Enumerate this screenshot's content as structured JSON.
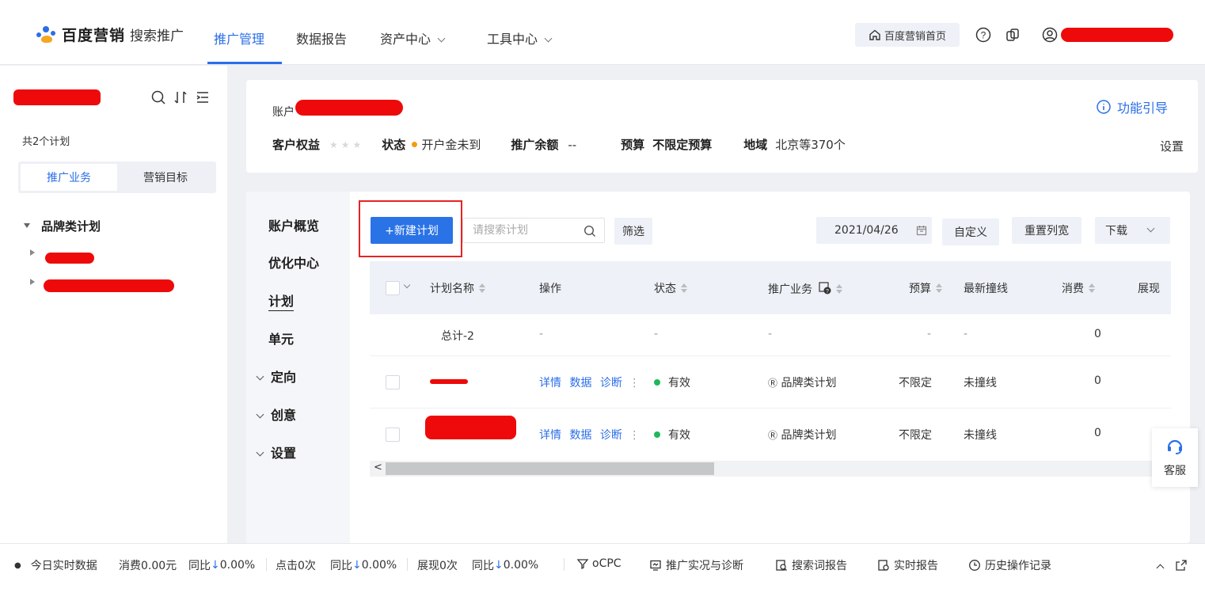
{
  "header": {
    "brand": "百度营销",
    "product": "搜索推广",
    "nav": [
      "推广管理",
      "数据报告",
      "资产中心",
      "工具中心"
    ],
    "home_button": "百度营销首页"
  },
  "sidebar": {
    "plan_count": "共2个计划",
    "tabs": [
      "推广业务",
      "营销目标"
    ],
    "tree_root": "品牌类计划"
  },
  "account": {
    "label": "账户",
    "rights_label": "客户权益",
    "status_label": "状态",
    "status_value": "开户金未到",
    "balance_label": "推广余额",
    "balance_value": "--",
    "budget_label": "预算",
    "budget_value": "不限定预算",
    "region_label": "地域",
    "region_value": "北京等370个",
    "guide": "功能引导",
    "settings": "设置"
  },
  "left_nav": [
    "账户概览",
    "优化中心",
    "计划",
    "单元",
    "定向",
    "创意",
    "设置"
  ],
  "toolbar": {
    "new_plan": "+新建计划",
    "search_placeholder": "请搜索计划",
    "filter": "筛选",
    "date": "2021/04/26",
    "custom": "自定义",
    "reset_width": "重置列宽",
    "download": "下载"
  },
  "table": {
    "headers": [
      "计划名称",
      "操作",
      "状态",
      "推广业务",
      "预算",
      "最新撞线",
      "消费",
      "展现"
    ],
    "total": {
      "name": "总计-2",
      "op": "-",
      "status": "-",
      "business": "-",
      "budget": "-",
      "latest": "-",
      "cost": "0"
    },
    "rows": [
      {
        "actions": [
          "详情",
          "数据",
          "诊断"
        ],
        "status": "有效",
        "business": "品牌类计划",
        "budget": "不限定",
        "latest": "未撞线",
        "cost": "0"
      },
      {
        "actions": [
          "详情",
          "数据",
          "诊断"
        ],
        "status": "有效",
        "business": "品牌类计划",
        "budget": "不限定",
        "latest": "未撞线",
        "cost": "0"
      }
    ]
  },
  "service": "客服",
  "bottom": {
    "realtime": "今日实时数据",
    "cost": "消费0.00元",
    "yoy1": "同比",
    "yoy1_value": "0.00%",
    "clicks": "点击0次",
    "yoy2": "同比",
    "yoy2_value": "0.00%",
    "impressions": "展现0次",
    "yoy3": "同比",
    "yoy3_value": "0.00%",
    "ocpc": "oCPC",
    "diagnosis": "推广实况与诊断",
    "search_report": "搜索词报告",
    "realtime_report": "实时报告",
    "history": "历史操作记录"
  },
  "colors": {
    "accent": "#2a6ee8",
    "status_ok": "#1fb85a",
    "status_warn": "#f39c12",
    "highlight": "#e72323"
  }
}
